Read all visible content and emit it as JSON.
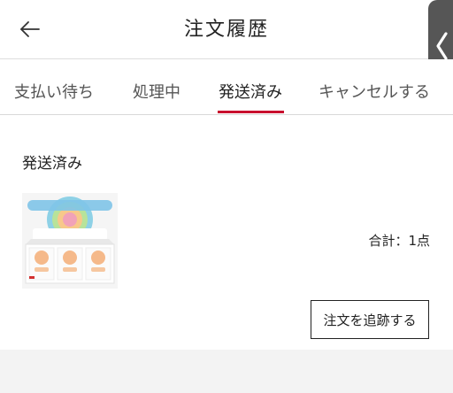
{
  "header": {
    "title": "注文履歴",
    "back_icon": "arrow-left-icon"
  },
  "edge_handle": {
    "icon": "chevron-left-icon"
  },
  "tabs": [
    {
      "label": "支払い待ち",
      "active": false
    },
    {
      "label": "処理中",
      "active": false
    },
    {
      "label": "発送済み",
      "active": true
    },
    {
      "label": "キャンセルする",
      "active": false
    }
  ],
  "order": {
    "status": "発送済み",
    "total": "合計：1点",
    "track_label": "注文を追跡する",
    "product_image": "product-box-image"
  },
  "colors": {
    "accent": "#c8102e",
    "background": "#f3f3f3"
  }
}
